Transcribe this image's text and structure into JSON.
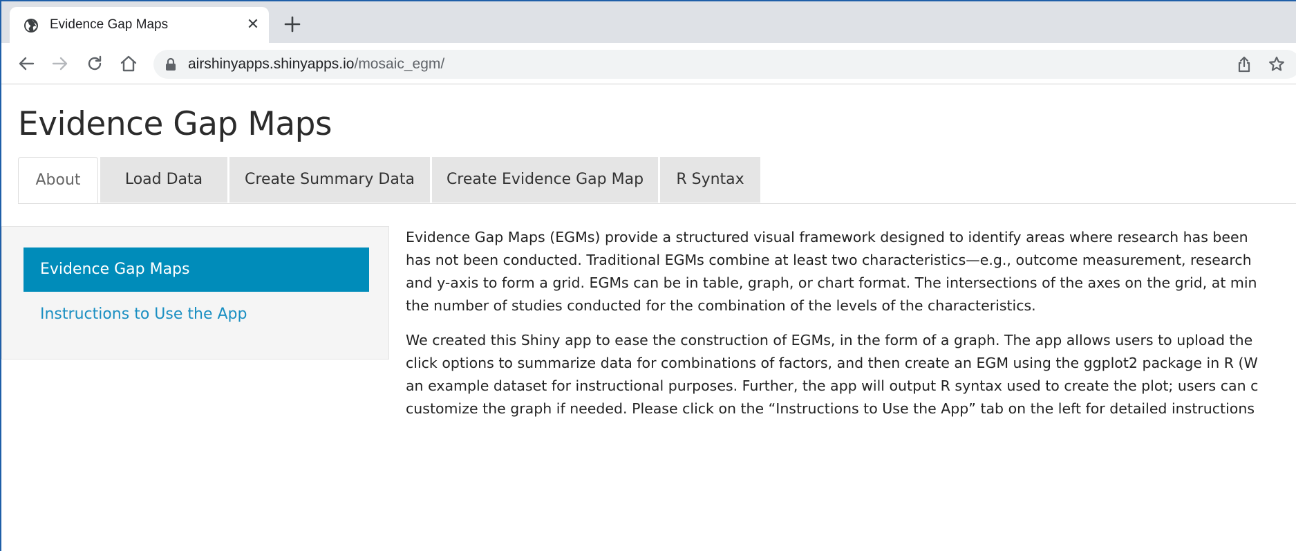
{
  "browser": {
    "tab_title": "Evidence Gap Maps",
    "close_glyph": "✕",
    "url_host": "airshinyapps.shinyapps.io",
    "url_path": "/mosaic_egm/"
  },
  "page": {
    "title": "Evidence Gap Maps",
    "tabs": [
      {
        "label": "About",
        "active": true
      },
      {
        "label": "Load Data",
        "active": false
      },
      {
        "label": "Create Summary Data",
        "active": false
      },
      {
        "label": "Create Evidence Gap Map",
        "active": false
      },
      {
        "label": "R Syntax",
        "active": false
      }
    ],
    "sidebar": {
      "items": [
        {
          "label": "Evidence Gap Maps",
          "active": true
        },
        {
          "label": "Instructions to Use the App",
          "active": false
        }
      ]
    },
    "content": {
      "paragraphs": [
        {
          "lines": [
            "Evidence Gap Maps (EGMs) provide a structured visual framework designed to identify areas where research has been",
            "has not been conducted. Traditional EGMs combine at least two characteristics—e.g., outcome measurement, research",
            "and y-axis to form a grid. EGMs can be in table, graph, or chart format. The intersections of the axes on the grid, at min",
            "the number of studies conducted for the combination of the levels of the characteristics."
          ]
        },
        {
          "lines": [
            "We created this Shiny app to ease the construction of EGMs, in the form of a graph. The app allows users to upload the",
            "click options to summarize data for combinations of factors, and then create an EGM using the ggplot2 package in R (W",
            "an example dataset for instructional purposes. Further, the app will output R syntax used to create the plot; users can c",
            "customize the graph if needed. Please click on the “Instructions to Use the App” tab on the left for detailed instructions"
          ]
        }
      ]
    }
  },
  "colors": {
    "accent": "#008cba",
    "link": "#1a8fc2",
    "tabstrip": "#dee1e6",
    "inactive_tab": "#e5e5e5"
  }
}
